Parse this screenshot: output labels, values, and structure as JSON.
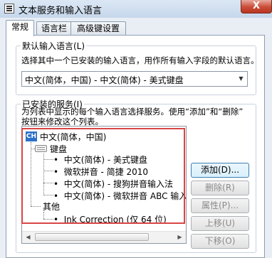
{
  "window": {
    "title": "文本服务和输入语言",
    "close_label": "X"
  },
  "tabs": [
    {
      "label": "常规",
      "active": true
    },
    {
      "label": "语言栏",
      "active": false
    },
    {
      "label": "高级键设置",
      "active": false
    }
  ],
  "default_language": {
    "group_label": "默认输入语言(L)",
    "description": "选择其中一个已安装的输入语言，用作所有输入字段的默认语言。",
    "selected": "中文(简体，中国) - 中文(简体) - 美式键盘"
  },
  "installed_services": {
    "group_label": "已安装的服务(I)",
    "description_line1": "为列表中显示的每个输入语言选择服务。使用“添加”和“删除”",
    "description_line2": "按钮来修改这个列表。",
    "tree": {
      "language_badge": "CH",
      "language": "中文(简体，中国)",
      "keyboard_group": "键盘",
      "keyboards": [
        "中文(简体) - 美式键盘",
        "微软拼音 - 简捷 2010",
        "中文(简体) - 搜狗拼音输入法",
        "中文(简体) - 微软拼音 ABC 输入风"
      ],
      "other_group": "其他",
      "others": [
        "Ink Correction (仅 64 位)"
      ]
    },
    "buttons": {
      "add": "添加(D)...",
      "remove": "删除(R)",
      "properties": "属性(P)...",
      "move_up": "上移(U)",
      "move_down": "下移(O)"
    }
  }
}
